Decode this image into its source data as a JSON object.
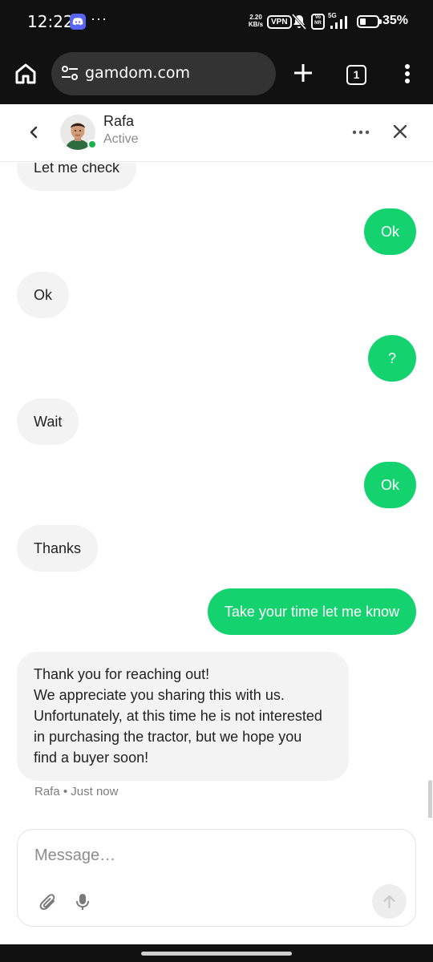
{
  "status_bar": {
    "time": "12:22",
    "net_speed_value": "2.20",
    "net_speed_unit": "KB/s",
    "vpn": "VPN",
    "volte": "Vo NR",
    "network": "5G",
    "battery_pct": "35%",
    "battery_level": 0.35
  },
  "browser": {
    "url": "gamdom.com",
    "tab_count": "1"
  },
  "chat": {
    "contact_name": "Rafa",
    "contact_status": "Active",
    "accent_color": "#14d36f",
    "messages": [
      {
        "dir": "in",
        "text": "Let me check"
      },
      {
        "dir": "out",
        "text": "Ok"
      },
      {
        "dir": "in",
        "text": "Ok"
      },
      {
        "dir": "out",
        "text": "?"
      },
      {
        "dir": "in",
        "text": "Wait"
      },
      {
        "dir": "out",
        "text": "Ok"
      },
      {
        "dir": "in",
        "text": "Thanks"
      },
      {
        "dir": "out",
        "text": "Take your time let me know"
      },
      {
        "dir": "in",
        "lines": [
          "Thank you for reaching out!",
          "We appreciate you sharing this with us.",
          "Unfortunately, at this time he is not interested",
          "in purchasing the tractor, but we hope you",
          "find a buyer soon!"
        ]
      }
    ],
    "last_meta_sender": "Rafa",
    "last_meta_time": "Just now"
  },
  "composer": {
    "placeholder": "Message…"
  },
  "icons": {
    "home": "home-icon",
    "site_settings": "tune-icon",
    "new_tab": "plus-icon",
    "menu": "more-vert-icon",
    "back": "chevron-left-icon",
    "more": "more-horiz-icon",
    "close": "close-icon",
    "attach": "paperclip-icon",
    "mic": "mic-icon",
    "send": "arrow-up-icon"
  }
}
